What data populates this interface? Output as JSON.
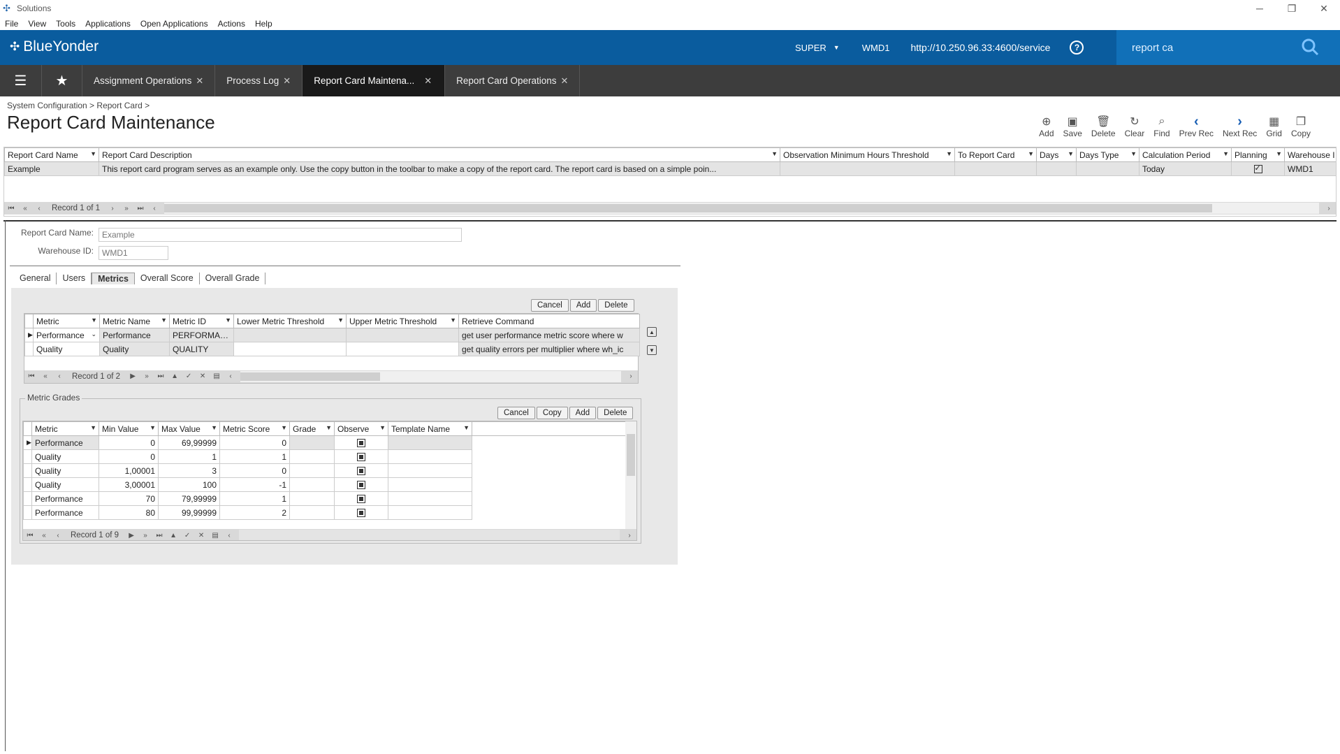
{
  "window": {
    "title": "Solutions"
  },
  "menu": [
    "File",
    "View",
    "Tools",
    "Applications",
    "Open Applications",
    "Actions",
    "Help"
  ],
  "header": {
    "brand": "BlueYonder",
    "user": "SUPER",
    "warehouse": "WMD1",
    "url": "http://10.250.96.33:4600/service",
    "search_value": "report ca"
  },
  "tabs": [
    {
      "label": "Assignment Operations"
    },
    {
      "label": "Process Log"
    },
    {
      "label": "Report Card Maintena..."
    },
    {
      "label": "Report Card Operations"
    }
  ],
  "breadcrumb": "System Configuration > Report Card >",
  "page_title": "Report Card Maintenance",
  "toolbar": {
    "add": "Add",
    "save": "Save",
    "delete": "Delete",
    "clear": "Clear",
    "find": "Find",
    "prev": "Prev Rec",
    "next": "Next Rec",
    "grid": "Grid",
    "copy": "Copy"
  },
  "main_grid": {
    "columns": [
      "Report Card Name",
      "Report Card Description",
      "Observation Minimum Hours Threshold",
      "To Report Card",
      "Days",
      "Days Type",
      "Calculation Period",
      "Planning",
      "Warehouse I"
    ],
    "row": {
      "name": "Example",
      "description": "This report card program serves as an example only. Use the copy button in the toolbar to make a copy of the report card. The report card is based on a simple poin...",
      "calc_period": "Today",
      "planning": true,
      "warehouse": "WMD1"
    },
    "record_text": "Record 1 of 1"
  },
  "form": {
    "name_label": "Report Card Name:",
    "name_value": "Example",
    "wh_label": "Warehouse ID:",
    "wh_value": "WMD1"
  },
  "subtabs": [
    "General",
    "Users",
    "Metrics",
    "Overall Score",
    "Overall Grade"
  ],
  "metrics": {
    "buttons": {
      "cancel": "Cancel",
      "add": "Add",
      "delete": "Delete"
    },
    "columns": [
      "Metric",
      "Metric Name",
      "Metric ID",
      "Lower Metric Threshold",
      "Upper Metric Threshold",
      "Retrieve Command"
    ],
    "rows": [
      {
        "metric": "Performance",
        "name": "Performance",
        "id": "PERFORMANCE",
        "cmd": "get user performance metric score where w"
      },
      {
        "metric": "Quality",
        "name": "Quality",
        "id": "QUALITY",
        "cmd": "get quality errors per multiplier where wh_ic"
      }
    ],
    "record_text": "Record 1 of 2"
  },
  "grades": {
    "title": "Metric Grades",
    "buttons": {
      "cancel": "Cancel",
      "copy": "Copy",
      "add": "Add",
      "delete": "Delete"
    },
    "columns": [
      "Metric",
      "Min Value",
      "Max Value",
      "Metric Score",
      "Grade",
      "Observe",
      "Template Name"
    ],
    "rows": [
      {
        "metric": "Performance",
        "min": "0",
        "max": "69,99999",
        "score": "0"
      },
      {
        "metric": "Quality",
        "min": "0",
        "max": "1",
        "score": "1"
      },
      {
        "metric": "Quality",
        "min": "1,00001",
        "max": "3",
        "score": "0"
      },
      {
        "metric": "Quality",
        "min": "3,00001",
        "max": "100",
        "score": "-1"
      },
      {
        "metric": "Performance",
        "min": "70",
        "max": "79,99999",
        "score": "1"
      },
      {
        "metric": "Performance",
        "min": "80",
        "max": "99,99999",
        "score": "2"
      }
    ],
    "record_text": "Record 1 of 9"
  }
}
